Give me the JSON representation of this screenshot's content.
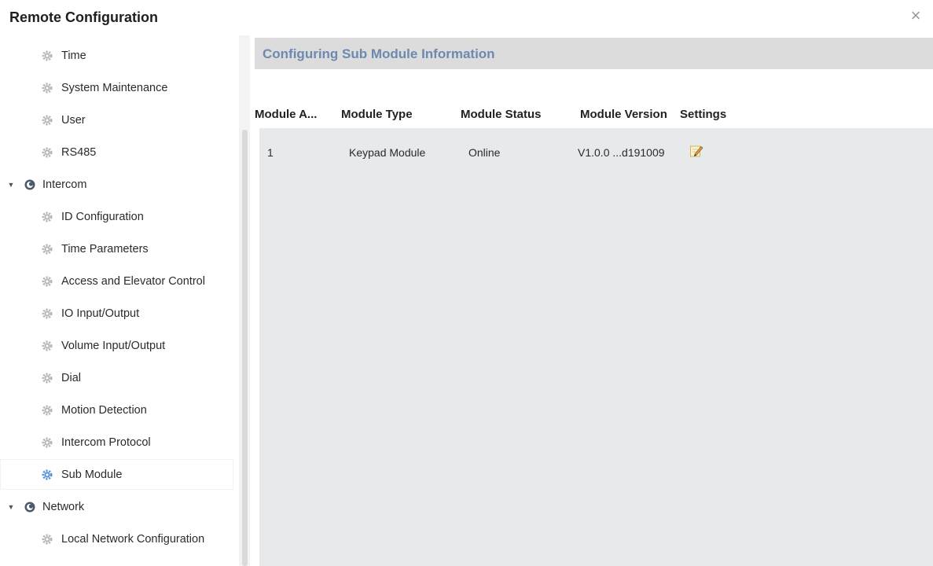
{
  "window": {
    "title": "Remote Configuration",
    "close_symbol": "×"
  },
  "sidebar": {
    "items": [
      {
        "label": "Time",
        "kind": "child",
        "icon": "gear-icon"
      },
      {
        "label": "System Maintenance",
        "kind": "child",
        "icon": "gear-icon"
      },
      {
        "label": "User",
        "kind": "child",
        "icon": "gear-icon"
      },
      {
        "label": "RS485",
        "kind": "child",
        "icon": "gear-icon"
      },
      {
        "label": "Intercom",
        "kind": "group",
        "icon": "settings-group-icon",
        "caret": "▼"
      },
      {
        "label": "ID Configuration",
        "kind": "child",
        "icon": "gear-icon"
      },
      {
        "label": "Time Parameters",
        "kind": "child",
        "icon": "gear-icon"
      },
      {
        "label": "Access and Elevator Control",
        "kind": "child",
        "icon": "gear-icon"
      },
      {
        "label": "IO Input/Output",
        "kind": "child",
        "icon": "gear-icon"
      },
      {
        "label": "Volume Input/Output",
        "kind": "child",
        "icon": "gear-icon"
      },
      {
        "label": "Dial",
        "kind": "child",
        "icon": "gear-icon"
      },
      {
        "label": "Motion Detection",
        "kind": "child",
        "icon": "gear-icon"
      },
      {
        "label": "Intercom Protocol",
        "kind": "child",
        "icon": "gear-icon"
      },
      {
        "label": "Sub Module",
        "kind": "child",
        "icon": "gear-icon",
        "selected": true
      },
      {
        "label": "Network",
        "kind": "group",
        "icon": "settings-group-icon",
        "caret": "▼"
      },
      {
        "label": "Local Network Configuration",
        "kind": "child",
        "icon": "gear-icon"
      }
    ]
  },
  "main": {
    "section_title": "Configuring Sub Module Information",
    "table": {
      "columns": [
        "Module A...",
        "Module Type",
        "Module Status",
        "Module Version",
        "Settings"
      ],
      "rows": [
        {
          "address": "1",
          "type": "Keypad Module",
          "status": "Online",
          "version": "V1.0.0 ...d191009",
          "settings_icon": "edit-icon"
        }
      ]
    }
  },
  "colors": {
    "accent_title": "#6d89b0",
    "header_bg": "#dcdcdc",
    "table_bg": "#e8e9ea",
    "selected_gear": "#5b8fd6",
    "gear": "#b5b5b5"
  }
}
